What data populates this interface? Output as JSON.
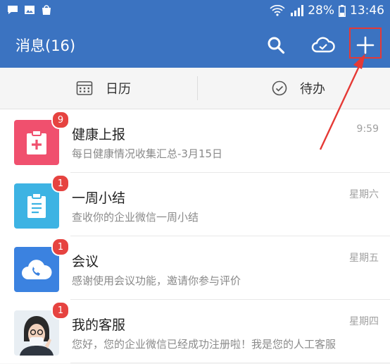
{
  "status": {
    "battery": "28%",
    "time": "13:46"
  },
  "header": {
    "title": "消息(16)"
  },
  "tabs": [
    {
      "label": "日历"
    },
    {
      "label": "待办"
    }
  ],
  "messages": [
    {
      "name": "健康上报",
      "preview": "每日健康情况收集汇总-3月15日",
      "time": "9:59",
      "badge": "9",
      "icon": "health-report-icon",
      "color": "#f0506e"
    },
    {
      "name": "一周小结",
      "preview": "查收你的企业微信一周小结",
      "time": "星期六",
      "badge": "1",
      "icon": "clipboard-icon",
      "color": "#3db3e3"
    },
    {
      "name": "会议",
      "preview": "感谢使用会议功能，邀请你参与评价",
      "time": "星期五",
      "badge": "1",
      "icon": "cloud-phone-icon",
      "color": "#3b82e0"
    },
    {
      "name": "我的客服",
      "preview": "您好，您的企业微信已经成功注册啦！我是您的人工客服",
      "time": "星期四",
      "badge": "1",
      "icon": "avatar-photo",
      "color": "#e8eef3"
    }
  ],
  "colors": {
    "primary": "#3b73c1",
    "badge": "#e64340",
    "annotation": "#e53935"
  }
}
